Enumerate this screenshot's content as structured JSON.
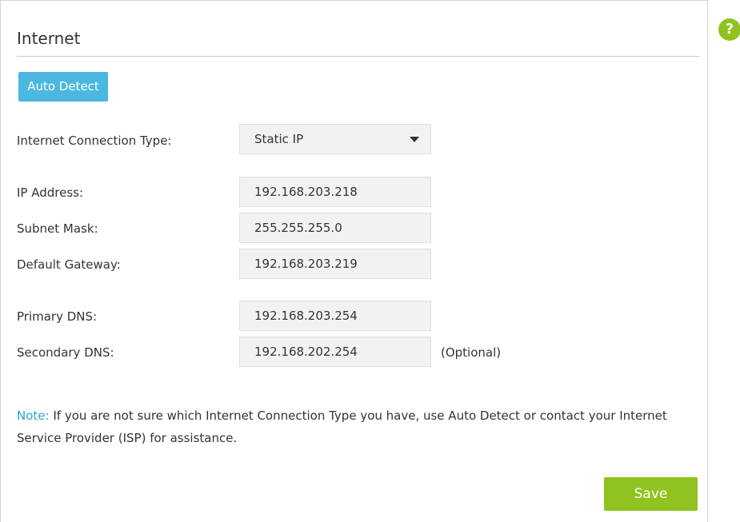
{
  "help": {
    "icon": "help-icon",
    "glyph": "?"
  },
  "section": {
    "title": "Internet"
  },
  "actions": {
    "auto_detect_label": "Auto Detect",
    "save_label": "Save"
  },
  "connection_type": {
    "label": "Internet Connection Type:",
    "value": "Static IP"
  },
  "fields": {
    "ip_address": {
      "label": "IP Address:",
      "value": "192.168.203.218"
    },
    "subnet_mask": {
      "label": "Subnet Mask:",
      "value": "255.255.255.0"
    },
    "default_gateway": {
      "label": "Default Gateway:",
      "value": "192.168.203.219"
    },
    "primary_dns": {
      "label": "Primary DNS:",
      "value": "192.168.203.254"
    },
    "secondary_dns": {
      "label": "Secondary DNS:",
      "value": "192.168.202.254",
      "hint": "(Optional)"
    }
  },
  "note": {
    "label": "Note:",
    "text": "If you are not sure which Internet Connection Type you have, use Auto Detect or contact your Internet Service Provider (ISP) for assistance."
  },
  "colors": {
    "accent_blue": "#4ab8e0",
    "accent_green": "#8fc31f",
    "note_blue": "#2aa6d6",
    "field_bg": "#f2f2f2"
  }
}
